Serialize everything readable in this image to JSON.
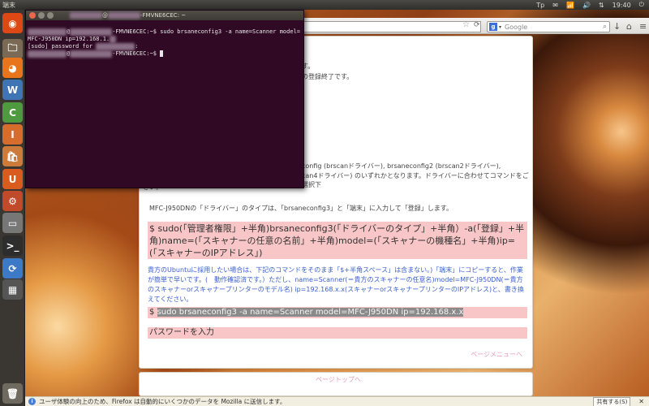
{
  "top_panel": {
    "title": "端末",
    "indicators": [
      "Tp",
      "✉",
      "📶",
      "🔊",
      "⇅"
    ],
    "clock": "19:40",
    "power": "⏻"
  },
  "launcher": {
    "items": [
      {
        "name": "ubuntu-dash-icon",
        "glyph": "◉",
        "color": "#dd4814"
      },
      {
        "name": "files-icon",
        "glyph": "🗀",
        "color": "#7a6a55"
      },
      {
        "name": "firefox-icon",
        "glyph": "◕",
        "color": "#e8741c"
      },
      {
        "name": "writer-icon",
        "glyph": "W",
        "color": "#3f74b5"
      },
      {
        "name": "calc-icon",
        "glyph": "C",
        "color": "#4f9a3f"
      },
      {
        "name": "impress-icon",
        "glyph": "I",
        "color": "#d66d2d"
      },
      {
        "name": "software-center-icon",
        "glyph": "🛍",
        "color": "#cc7b3a"
      },
      {
        "name": "ubuntu-one-icon",
        "glyph": "U",
        "color": "#d95c1e"
      },
      {
        "name": "settings-icon",
        "glyph": "⚙",
        "color": "#c04a2a"
      },
      {
        "name": "scanner-icon",
        "glyph": "▭",
        "color": "#777"
      },
      {
        "name": "terminal-icon",
        "glyph": ">_",
        "color": "#2d2d2d"
      },
      {
        "name": "update-icon",
        "glyph": "⟳",
        "color": "#3c79c7"
      },
      {
        "name": "workspace-icon",
        "glyph": "▦",
        "color": "#555"
      },
      {
        "name": "trash-icon",
        "glyph": "🗑",
        "color": "#6f6a60"
      }
    ]
  },
  "terminal": {
    "title_suffix": "-FMVNE6CEC: ~",
    "lines": {
      "l1_prompt_end": "-FMVNE6CEC:~$ sudo brsaneconfig3 -a name=Scanner model=",
      "l2": "MFC-J950DN ip=192.168.1.",
      "l3": "[sudo] password for ",
      "l3_end": ":",
      "l4_prompt_end": "-FMVNE6CEC:~$ "
    }
  },
  "firefox": {
    "search_placeholder": "Google",
    "search_engine": "g"
  },
  "article": {
    "frag1": "す。",
    "frag2": "の登録終了です。",
    "frag3": "config (brscanドライバー), brsaneconfig2 (brscan2ドライバー),",
    "frag4": "can4ドライバー) のいずれかとなります。ドライバーに合わせてコマンドをご選択下",
    "frag5": "さい。",
    "driver_line": "MFC-J950DNの「ドライバー」のタイプは、「brsaneconfig3」と「端末」に入力して「登録」します。",
    "cmd_template": "$ sudo(「管理者権限」+半角)brsaneconfig3(「ドライバーのタイプ」+半角）-a(「登録」+半角)name=(「スキャナーの任意の名前」+半角)model=(「スキャナーの機種名」+半角)ip=(「スキャナーのIPアドレス」)",
    "blue_note": "貴方のUbuntuに採用したい場合は、下記のコマンドをそのまま「$+半角スペース」は含まない。)「端末」にコピーすると、作業が簡単で早いです。(　動作確認済です。）ただし、name=Scanner(＝貴方のスキャナーの任意名)model=MFC-J950DN(＝貴方のスキャナーorスキャナープリンターのモデル名) ip=192.168.x.x(スキャナーorスキャナープリンターのIPアドレス)と、書き換えてください。",
    "cmd_dollar": "$",
    "cmd_selected": "sudo brsaneconfig3 -a name=Scanner model=MFC-J950DN ip=192.168.x.x",
    "password_box": "パスワードを入力",
    "page_menu_link": "ページメニューへ",
    "page_top_link": "ページトップへ"
  },
  "notification": {
    "message": "ユーザ体験の向上のため、Firefox は自動的にいくつかのデータを Mozilla に送信します。",
    "share_button": "共有する(S)",
    "close": "✕"
  }
}
